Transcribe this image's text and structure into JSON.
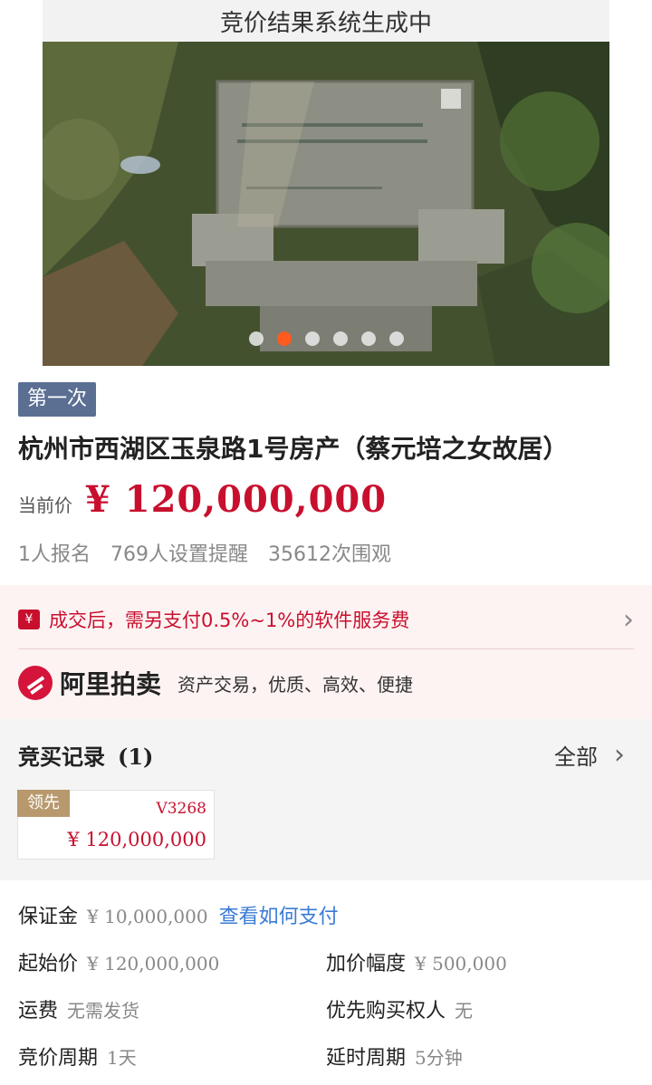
{
  "status_bar": {
    "text": "竞价结果系统生成中"
  },
  "carousel": {
    "dot_count": 6,
    "active_index": 1
  },
  "auction": {
    "round_badge": "第一次",
    "title": "杭州市西湖区玉泉路1号房产（蔡元培之女故居）",
    "price_label": "当前价",
    "price_value": "¥ 120,000,000",
    "stats": {
      "signups": "1人报名",
      "reminders": "769人设置提醒",
      "views": "35612次围观"
    }
  },
  "fee_notice": {
    "icon_text": "¥",
    "text": "成交后，需另支付0.5%~1%的软件服务费"
  },
  "ali": {
    "brand": "阿里拍卖",
    "slogan": "资产交易，优质、高效、便捷"
  },
  "bid_records": {
    "title": "竞买记录",
    "count": "(1)",
    "all_label": "全部",
    "records": [
      {
        "tag": "领先",
        "bidder": "V3268",
        "amount": "¥ 120,000,000"
      }
    ]
  },
  "details": {
    "deposit": {
      "label": "保证金",
      "value": "¥ 10,000,000",
      "link": "查看如何支付"
    },
    "start_price": {
      "label": "起始价",
      "value": "¥ 120,000,000"
    },
    "increment": {
      "label": "加价幅度",
      "value": "¥ 500,000"
    },
    "shipping": {
      "label": "运费",
      "value": "无需发货"
    },
    "priority": {
      "label": "优先购买权人",
      "value": "无"
    },
    "cycle": {
      "label": "竞价周期",
      "value": "1天"
    },
    "delay": {
      "label": "延时周期",
      "value": "5分钟"
    }
  },
  "colors": {
    "price_red": "#c8102e",
    "badge_blue": "#5b6f93",
    "lead_gold": "#b8996d",
    "link_blue": "#3a7bd5",
    "dot_active": "#ff5a1f"
  }
}
